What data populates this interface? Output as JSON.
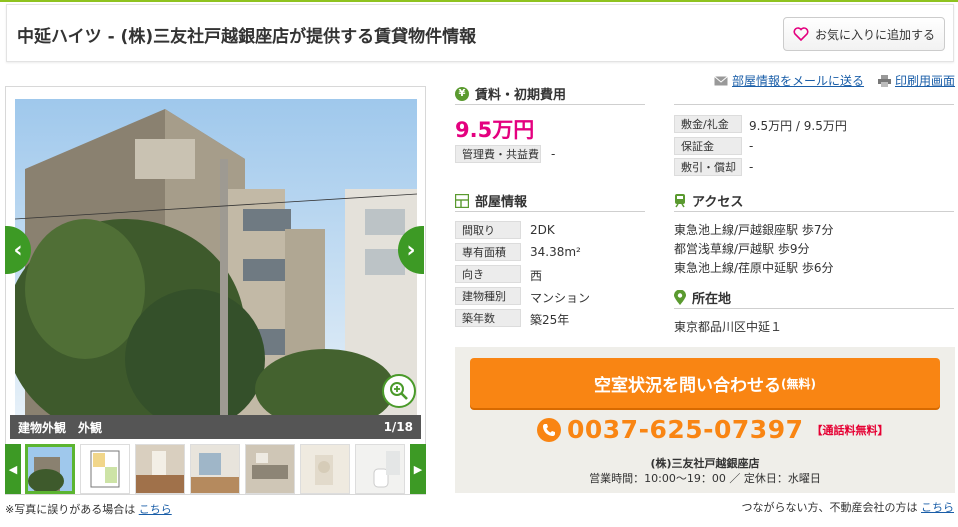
{
  "header": {
    "title": "中延ハイツ - (株)三友社戸越銀座店が提供する賃貸物件情報",
    "favorite_button": "お気に入りに追加する"
  },
  "gallery": {
    "caption_left": "建物外観　外観",
    "caption_right": "1/18",
    "photo_note": "※写真に誤りがある場合は",
    "photo_note_link": "こちら",
    "thumbnail_count": 7
  },
  "links": {
    "mail": "部屋情報をメールに送る",
    "print": "印刷用画面"
  },
  "rent": {
    "section_title": "賃料・初期費用",
    "price": "9.5万円",
    "management_fee_label": "管理費・共益費",
    "management_fee_value": "-",
    "deposit_label": "敷金/礼金",
    "deposit_value": "9.5万円 / 9.5万円",
    "guarantee_label": "保証金",
    "guarantee_value": "-",
    "shikibiki_label": "敷引・償却",
    "shikibiki_value": "-"
  },
  "room": {
    "section_title": "部屋情報",
    "rows": [
      {
        "label": "間取り",
        "value": "2DK"
      },
      {
        "label": "専有面積",
        "value": "34.38m²"
      },
      {
        "label": "向き",
        "value": "西"
      },
      {
        "label": "建物種別",
        "value": "マンション"
      },
      {
        "label": "築年数",
        "value": "築25年"
      }
    ]
  },
  "access": {
    "section_title": "アクセス",
    "lines": [
      "東急池上線/戸越銀座駅 歩7分",
      "都営浅草線/戸越駅 歩9分",
      "東急池上線/荏原中延駅 歩6分"
    ]
  },
  "location": {
    "section_title": "所在地",
    "address": "東京都品川区中延１"
  },
  "contact": {
    "button_main": "空室状況を問い合わせる",
    "button_sub": "(無料)",
    "phone": "0037-625-07397",
    "phone_free": "【通話料無料】",
    "shop_name": "(株)三友社戸越銀座店",
    "hours": "営業時間：10:00～19：00 ／ 定休日：水曜日",
    "bottom_note": "つながらない方、不動産会社の方は",
    "bottom_note_link": "こちら"
  },
  "colors": {
    "accent_green": "#3d9a25",
    "price_pink": "#e4007f",
    "cta_orange": "#f98513"
  }
}
